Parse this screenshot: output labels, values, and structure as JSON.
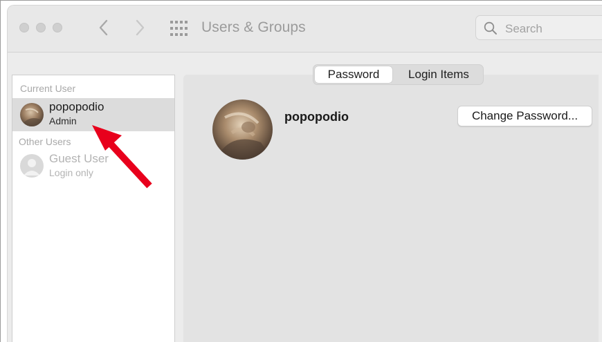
{
  "toolbar": {
    "title": "Users & Groups",
    "search_placeholder": "Search"
  },
  "sidebar": {
    "current_user_label": "Current User",
    "other_users_label": "Other Users",
    "current_user": {
      "name": "popopodio",
      "role": "Admin"
    },
    "other_users": [
      {
        "name": "Guest User",
        "subtitle": "Login only"
      }
    ]
  },
  "tabs": [
    {
      "label": "Password",
      "active": true
    },
    {
      "label": "Login Items",
      "active": false
    }
  ],
  "profile": {
    "name": "popopodio",
    "change_password_label": "Change Password..."
  },
  "icons": {
    "back": "chevron-left-icon",
    "forward": "chevron-right-icon",
    "show_all": "grid-icon",
    "search": "magnifier-icon",
    "annotation": "red-arrow"
  },
  "colors": {
    "annotation_arrow": "#e8001c",
    "selected_row": "#dcdcdc",
    "panel_bg": "#e3e3e3"
  }
}
